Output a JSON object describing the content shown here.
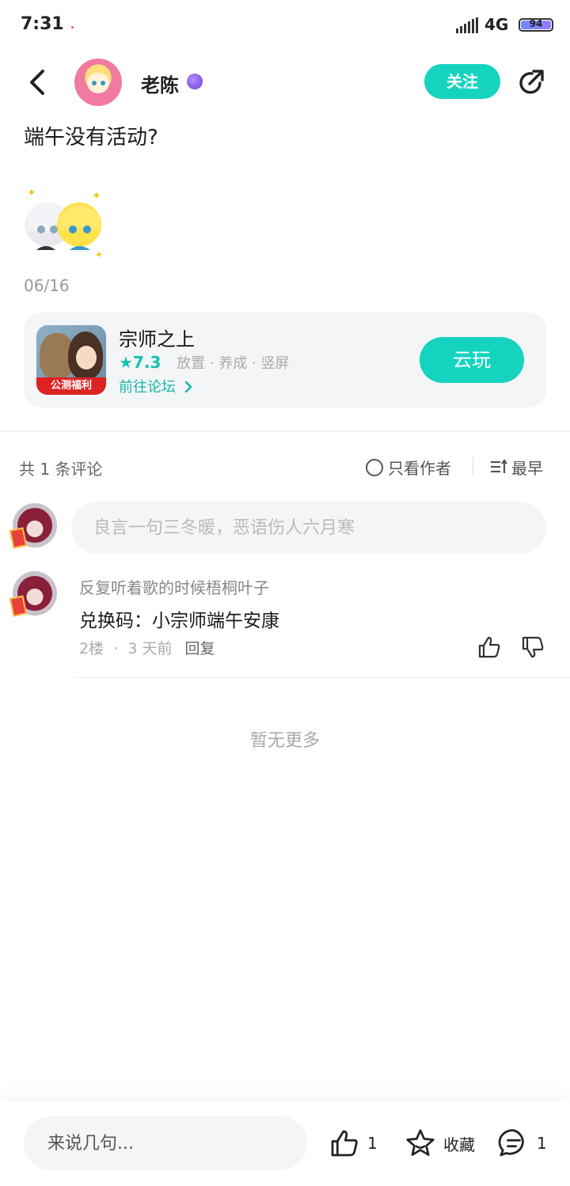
{
  "status_bar": {
    "time": "7:31",
    "network": "4G",
    "battery": "94",
    "battery_level": 0.94
  },
  "header": {
    "author_name": "老陈",
    "follow_label": "关注"
  },
  "post": {
    "title": "端午没有活动?",
    "date": "06/16"
  },
  "game_card": {
    "name": "宗师之上",
    "rating": "★7.3",
    "tags": [
      "放置",
      "养成",
      "竖屏"
    ],
    "separator": " · ",
    "forum_link": "前往论坛",
    "banner": "公测福利",
    "play_label": "云玩"
  },
  "comments_header": {
    "count_text": "共 1 条评论",
    "only_author": "只看作者",
    "sort_label": "最早"
  },
  "comment_input": {
    "placeholder": "良言一句三冬暖，恶语伤人六月寒"
  },
  "comments": [
    {
      "author": "反复听着歌的时候梧桐叶子",
      "text": "兑换码：小宗师端午安康",
      "floor": "2楼",
      "time": "3 天前",
      "reply_label": "回复"
    }
  ],
  "no_more_text": "暂无更多",
  "bottom_bar": {
    "input_placeholder": "来说几句...",
    "like_count": "1",
    "favorite_label": "收藏",
    "comment_count": "1"
  },
  "colors": {
    "accent": "#14d4c0",
    "accent_text": "#14b8a6",
    "muted": "#aaaaaa"
  }
}
